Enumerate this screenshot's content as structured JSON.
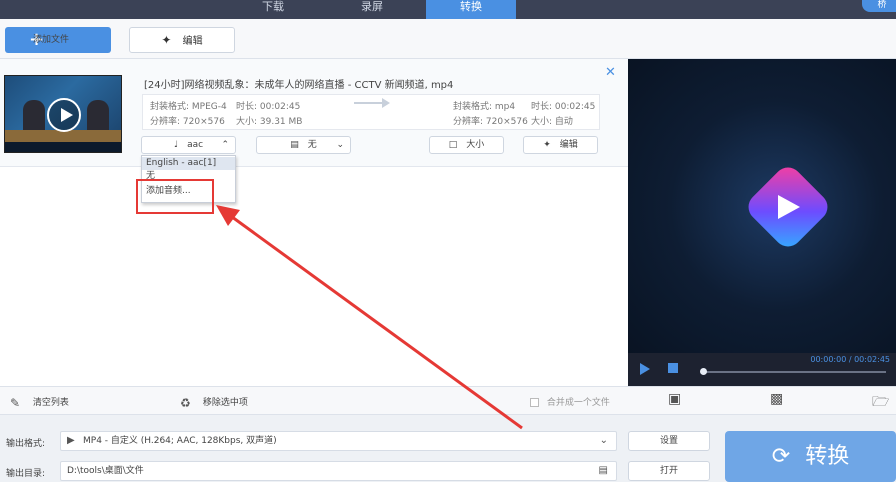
{
  "topbar": {
    "tabs": [
      {
        "label": "下载"
      },
      {
        "label": "录屏"
      },
      {
        "label": "转换"
      }
    ],
    "corner_label": "桥"
  },
  "toolbar": {
    "add_file_label": "添加文件",
    "edit_label": "编辑"
  },
  "file": {
    "title": "[24小时]网络视频乱象：未成年人的网络直播 - CCTV 新闻频道, mp4",
    "source": {
      "format": "封装格式: MPEG-4",
      "duration": "时长: 00:02:45",
      "resolution": "分辨率: 720×576",
      "size": "大小: 39.31 MB"
    },
    "target": {
      "format": "封装格式: mp4",
      "duration": "时长: 00:02:45",
      "resolution": "分辨率: 720×576",
      "size": "大小: 自动"
    },
    "audio_select": "aac",
    "subtitle_select": "无",
    "size_button": "大小",
    "edit_button": "编辑",
    "audio_options": [
      "English - aac[1]",
      "无",
      "添加音频..."
    ]
  },
  "preview": {
    "timecode": "00:00:00 / 00:02:45",
    "progress": 0
  },
  "actions": {
    "clear_list": "清空列表",
    "remove_selected": "移除选中项",
    "merge_label": "合并成一个文件"
  },
  "output": {
    "format_label": "输出格式:",
    "format_value": "MP4 - 自定义 (H.264; AAC, 128Kbps, 双声道)",
    "dir_label": "输出目录:",
    "dir_value": "D:\\tools\\桌面\\文件",
    "settings_button": "设置",
    "open_button": "打开",
    "convert_button": "转换"
  },
  "colors": {
    "accent": "#4a90e2",
    "highlight_red": "#e53935",
    "topbar_bg": "#3b4256"
  }
}
